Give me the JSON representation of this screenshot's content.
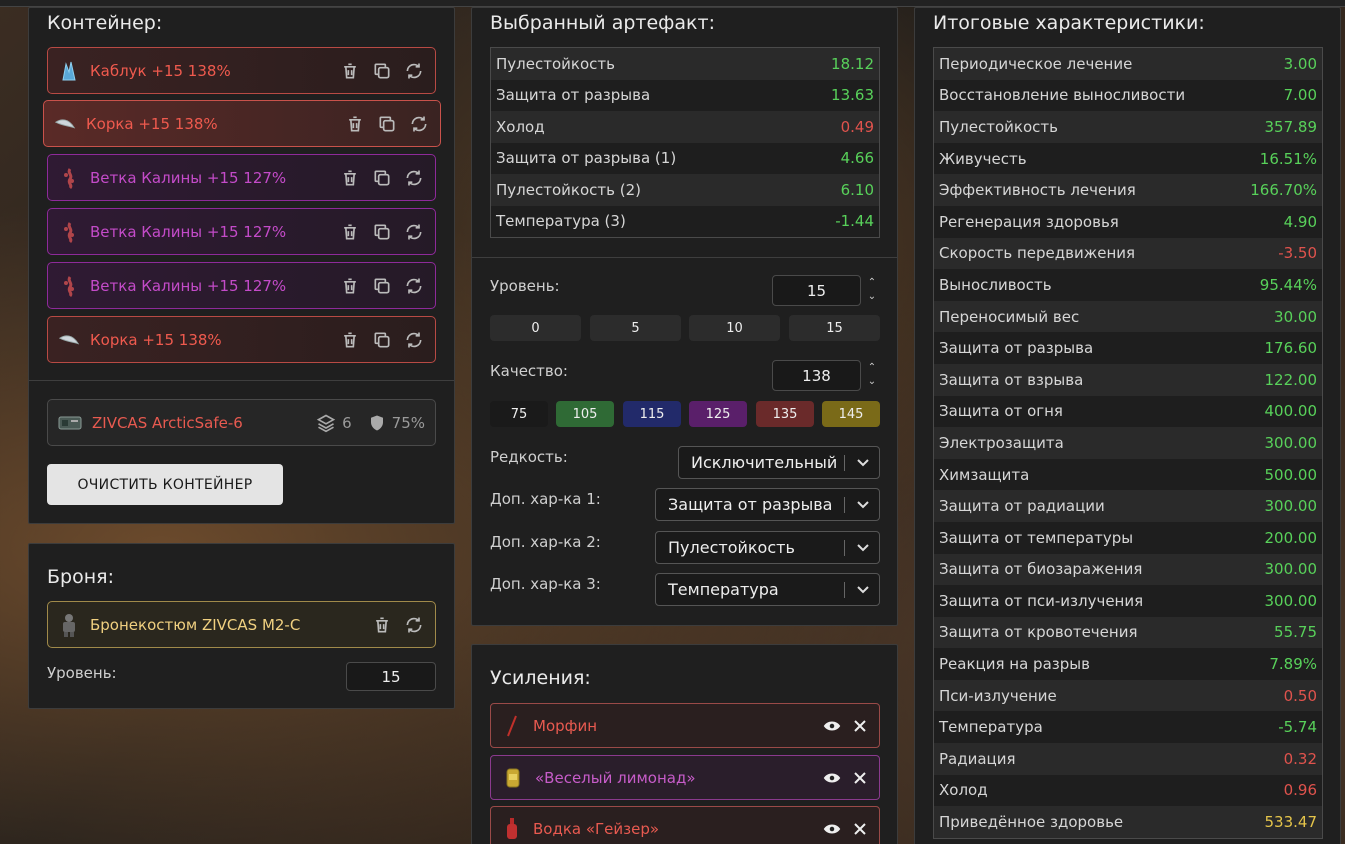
{
  "container_panel": {
    "title": "Контейнер:",
    "items": [
      {
        "name": "Каблук +15 138%",
        "rarity": "red",
        "icon": "crystal-icon"
      },
      {
        "name": "Корка +15 138%",
        "rarity": "red",
        "icon": "feather-icon",
        "active": true
      },
      {
        "name": "Ветка Калины +15 127%",
        "rarity": "purple",
        "icon": "branch-icon"
      },
      {
        "name": "Ветка Калины +15 127%",
        "rarity": "purple",
        "icon": "branch-icon"
      },
      {
        "name": "Ветка Калины +15 127%",
        "rarity": "purple",
        "icon": "branch-icon"
      },
      {
        "name": "Корка +15 138%",
        "rarity": "red",
        "icon": "feather-icon"
      }
    ],
    "container": {
      "name": "ZIVCAS ArcticSafe-6",
      "slots": "6",
      "protection": "75%"
    },
    "clear_button": "ОЧИСТИТЬ КОНТЕЙНЕР"
  },
  "armor_panel": {
    "title": "Броня:",
    "armor_name": "Бронекостюм ZIVCAS M2-C",
    "level_label": "Уровень:",
    "level_value": "15"
  },
  "artifact_panel": {
    "title": "Выбранный артефакт:",
    "stats": [
      {
        "k": "Пулестойкость",
        "v": "18.12",
        "c": "g"
      },
      {
        "k": "Защита от разрыва",
        "v": "13.63",
        "c": "g"
      },
      {
        "k": "Холод",
        "v": "0.49",
        "c": "r"
      },
      {
        "k": "Защита от разрыва (1)",
        "v": "4.66",
        "c": "g"
      },
      {
        "k": "Пулестойкость (2)",
        "v": "6.10",
        "c": "g"
      },
      {
        "k": "Температура (3)",
        "v": "-1.44",
        "c": "g"
      }
    ],
    "level_label": "Уровень:",
    "level_value": "15",
    "level_presets": [
      "0",
      "5",
      "10",
      "15"
    ],
    "quality_label": "Качество:",
    "quality_value": "138",
    "quality_presets": [
      {
        "label": "75",
        "color": "#1a1a1a"
      },
      {
        "label": "105",
        "color": "#2f6a35"
      },
      {
        "label": "115",
        "color": "#222a6a"
      },
      {
        "label": "125",
        "color": "#5a1f6a"
      },
      {
        "label": "135",
        "color": "#6a2a2a"
      },
      {
        "label": "145",
        "color": "#7a6a18"
      }
    ],
    "rarity_label": "Редкость:",
    "rarity_value": "Исключительный",
    "extra1_label": "Доп. хар-ка 1:",
    "extra1_value": "Защита от разрыва",
    "extra2_label": "Доп. хар-ка 2:",
    "extra2_value": "Пулестойкость",
    "extra3_label": "Доп. хар-ка 3:",
    "extra3_value": "Температура"
  },
  "boosts_panel": {
    "title": "Усиления:",
    "items": [
      {
        "name": "Морфин",
        "rarity": "red",
        "icon": "syringe-icon"
      },
      {
        "name": "«Веселый лимонад»",
        "rarity": "purple",
        "icon": "can-icon"
      },
      {
        "name": "Водка «Гейзер»",
        "rarity": "red",
        "icon": "bottle-icon"
      }
    ]
  },
  "totals_panel": {
    "title": "Итоговые характеристики:",
    "stats": [
      {
        "k": "Периодическое лечение",
        "v": "3.00",
        "c": "g"
      },
      {
        "k": "Восстановление выносливости",
        "v": "7.00",
        "c": "g"
      },
      {
        "k": "Пулестойкость",
        "v": "357.89",
        "c": "g"
      },
      {
        "k": "Живучесть",
        "v": "16.51%",
        "c": "g"
      },
      {
        "k": "Эффективность лечения",
        "v": "166.70%",
        "c": "g"
      },
      {
        "k": "Регенерация здоровья",
        "v": "4.90",
        "c": "g"
      },
      {
        "k": "Скорость передвижения",
        "v": "-3.50",
        "c": "r"
      },
      {
        "k": "Выносливость",
        "v": "95.44%",
        "c": "g"
      },
      {
        "k": "Переносимый вес",
        "v": "30.00",
        "c": "g"
      },
      {
        "k": "Защита от разрыва",
        "v": "176.60",
        "c": "g"
      },
      {
        "k": "Защита от взрыва",
        "v": "122.00",
        "c": "g"
      },
      {
        "k": "Защита от огня",
        "v": "400.00",
        "c": "g"
      },
      {
        "k": "Электрозащита",
        "v": "300.00",
        "c": "g"
      },
      {
        "k": "Химзащита",
        "v": "500.00",
        "c": "g"
      },
      {
        "k": "Защита от радиации",
        "v": "300.00",
        "c": "g"
      },
      {
        "k": "Защита от температуры",
        "v": "200.00",
        "c": "g"
      },
      {
        "k": "Защита от биозаражения",
        "v": "300.00",
        "c": "g"
      },
      {
        "k": "Защита от пси-излучения",
        "v": "300.00",
        "c": "g"
      },
      {
        "k": "Защита от кровотечения",
        "v": "55.75",
        "c": "g"
      },
      {
        "k": "Реакция на разрыв",
        "v": "7.89%",
        "c": "g"
      },
      {
        "k": "Пси-излучение",
        "v": "0.50",
        "c": "r"
      },
      {
        "k": "Температура",
        "v": "-5.74",
        "c": "g"
      },
      {
        "k": "Радиация",
        "v": "0.32",
        "c": "r"
      },
      {
        "k": "Холод",
        "v": "0.96",
        "c": "r"
      },
      {
        "k": "Приведённое здоровье",
        "v": "533.47",
        "c": "y"
      }
    ]
  }
}
